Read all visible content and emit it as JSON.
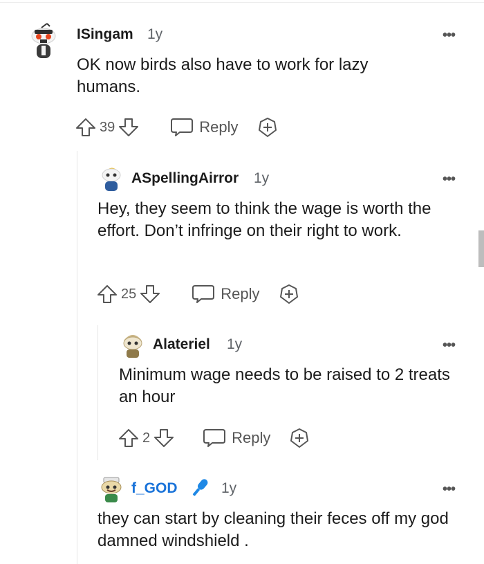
{
  "comments": [
    {
      "author": "ISingam",
      "age": "1y",
      "body": "OK now birds also have to work for lazy humans.",
      "score": "39",
      "reply_label": "Reply",
      "more_label": "•••"
    },
    {
      "author": "ASpellingAirror",
      "age": "1y",
      "body": "Hey, they seem to think the wage is worth the effort. Don’t infringe on their right to work.",
      "score": "25",
      "reply_label": "Reply",
      "more_label": "•••"
    },
    {
      "author": "Alateriel",
      "age": "1y",
      "body": "Minimum wage needs to be raised to 2 treats an hour",
      "score": "2",
      "reply_label": "Reply",
      "more_label": "•••"
    },
    {
      "author": "f_GOD",
      "age": "1y",
      "body": "they can start by cleaning their feces off my god damned windshield .",
      "more_label": "•••"
    }
  ],
  "icons": {
    "upvote": "arrow-up-icon",
    "downvote": "arrow-down-icon",
    "reply": "speech-bubble-icon",
    "award": "award-plus-icon",
    "mod": "microphone-icon"
  },
  "colors": {
    "mod_author": "#1a73d9",
    "text": "#1c1c1c",
    "muted": "#5f6368"
  }
}
